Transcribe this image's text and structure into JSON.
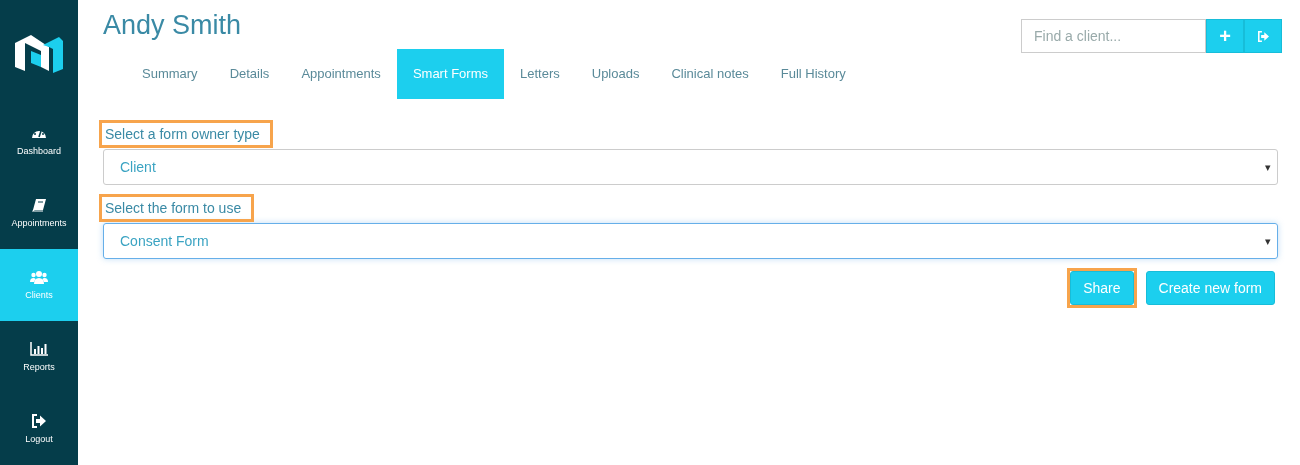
{
  "sidebar": {
    "items": [
      {
        "label": "Dashboard",
        "kind": "dashboard",
        "selected": false
      },
      {
        "label": "Appointments",
        "kind": "appointments",
        "selected": false
      },
      {
        "label": "Clients",
        "kind": "clients",
        "selected": true
      },
      {
        "label": "Reports",
        "kind": "reports",
        "selected": false
      },
      {
        "label": "Logout",
        "kind": "logout",
        "selected": false
      }
    ]
  },
  "header": {
    "title": "Andy Smith",
    "search": {
      "placeholder": "Find a client..."
    },
    "add_button": "+"
  },
  "tabs": [
    {
      "label": "Summary",
      "selected": false
    },
    {
      "label": "Details",
      "selected": false
    },
    {
      "label": "Appointments",
      "selected": false
    },
    {
      "label": "Smart Forms",
      "selected": true
    },
    {
      "label": "Letters",
      "selected": false
    },
    {
      "label": "Uploads",
      "selected": false
    },
    {
      "label": "Clinical notes",
      "selected": false
    },
    {
      "label": "Full History",
      "selected": false
    }
  ],
  "fields": [
    {
      "label": "Select a form owner type",
      "highlighted": true,
      "value": "Client",
      "caret": "▾",
      "focused": false
    },
    {
      "label": "Select the form to use",
      "highlighted": true,
      "value": "Consent Form",
      "caret": "▾",
      "focused": true
    }
  ],
  "buttons": [
    {
      "label": "Share",
      "highlighted": true
    },
    {
      "label": "Create new form",
      "highlighted": false
    }
  ]
}
